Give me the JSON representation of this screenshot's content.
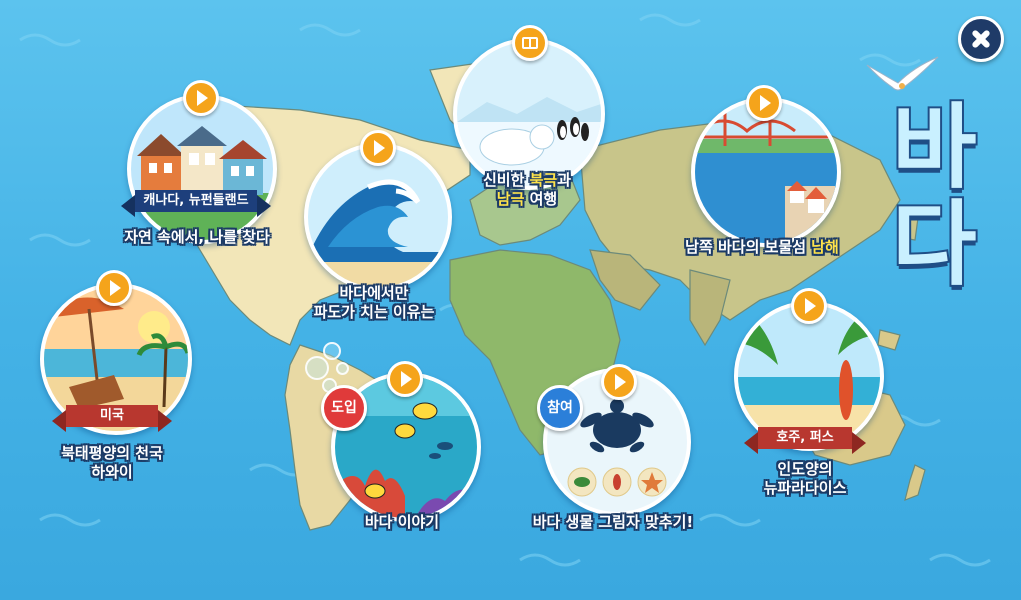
{
  "screen": {
    "title_chars": [
      "바",
      "다"
    ],
    "close_icon": "close-x-icon"
  },
  "stations": {
    "canada": {
      "ribbon": "캐나다, 뉴펀들랜드",
      "caption": "자연 속에서, 나를 찾다",
      "icon": "play-icon"
    },
    "waves": {
      "caption_line1": "바다에서만",
      "caption_line2": "파도가 치는 이유는",
      "icon": "play-icon"
    },
    "polar": {
      "caption_line1_pre": "신비한 ",
      "caption_line1_hl": "북극",
      "caption_line1_post": "과",
      "caption_line2_hl": "남극",
      "caption_line2_post": " 여행",
      "icon": "book-icon"
    },
    "namhae": {
      "caption_pre": "남쪽 바다의 보물섬 ",
      "caption_hl": "남해",
      "icon": "play-icon"
    },
    "hawaii": {
      "ribbon": "미국",
      "caption_line1": "북태평양의 천국",
      "caption_line2": "하와이",
      "icon": "play-icon"
    },
    "story": {
      "badge": "도입",
      "caption": "바다 이야기",
      "icon": "play-icon"
    },
    "shadow": {
      "badge": "참여",
      "caption": "바다 생물 그림자 맞추기!",
      "icon": "play-icon"
    },
    "perth": {
      "ribbon": "호주, 퍼스",
      "caption_line1": "인도양의",
      "caption_line2": "뉴파라다이스",
      "icon": "play-icon"
    }
  },
  "colors": {
    "ocean": "#44b2e6",
    "play_button": "#f5a41b",
    "outline": "#1b3a66",
    "highlight": "#ffe34a",
    "badge_intro": "#e03a3a",
    "badge_participate": "#2b7fd9"
  }
}
